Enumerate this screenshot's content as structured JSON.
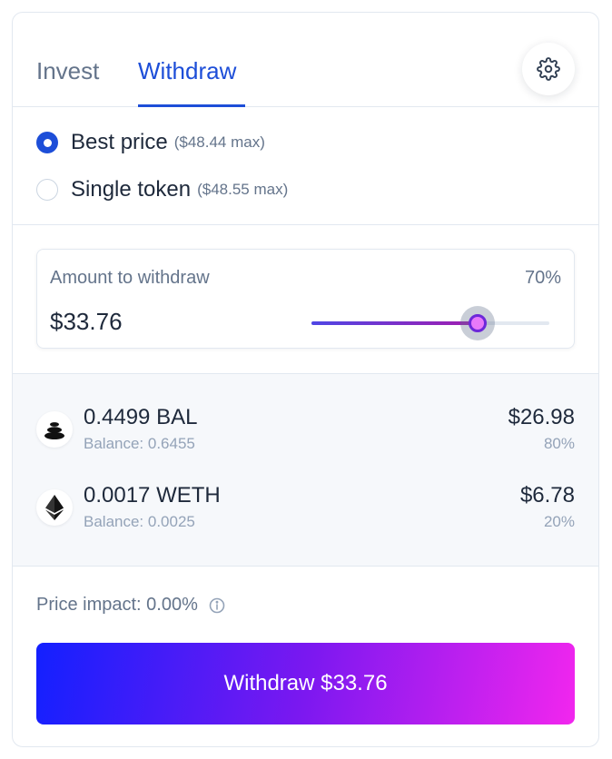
{
  "tabs": [
    {
      "label": "Invest",
      "active": false
    },
    {
      "label": "Withdraw",
      "active": true
    }
  ],
  "settings_icon": "gear-icon",
  "options": {
    "best_price": {
      "label": "Best price",
      "max": "($48.44 max)",
      "selected": true
    },
    "single_token": {
      "label": "Single token",
      "max": "($48.55 max)",
      "selected": false
    }
  },
  "amount": {
    "label": "Amount to withdraw",
    "value": "$33.76",
    "percent_label": "70%",
    "slider_percent": 70
  },
  "tokens": [
    {
      "amount": "0.4499 BAL",
      "balance": "Balance: 0.6455",
      "usd": "$26.98",
      "percent": "80%",
      "icon": "balancer-icon"
    },
    {
      "amount": "0.0017 WETH",
      "balance": "Balance: 0.0025",
      "usd": "$6.78",
      "percent": "20%",
      "icon": "ethereum-icon"
    }
  ],
  "price_impact": "Price impact: 0.00%",
  "withdraw_button": "Withdraw $33.76",
  "colors": {
    "accent": "#1d4ed8",
    "button_gradient_start": "#1320ff",
    "button_gradient_end": "#f226ee",
    "slider_start": "#4f46e5",
    "slider_end": "#a21caf"
  }
}
